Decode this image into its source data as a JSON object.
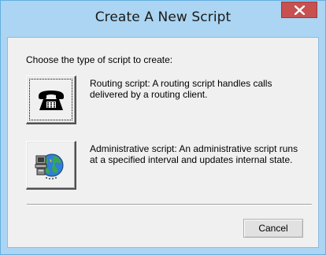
{
  "window": {
    "title": "Create A New Script"
  },
  "dialog": {
    "prompt": "Choose the type of script to create:",
    "options": [
      {
        "icon": "telephone-icon",
        "description": "Routing script: A routing script handles calls delivered by a routing client."
      },
      {
        "icon": "globe-computer-icon",
        "description": "Administrative script: An administrative script runs at a specified interval and updates internal state."
      }
    ],
    "cancel_label": "Cancel"
  },
  "colors": {
    "titlebar": "#abd5f2",
    "close_button": "#c75050",
    "client_background": "#f0f0f0"
  }
}
